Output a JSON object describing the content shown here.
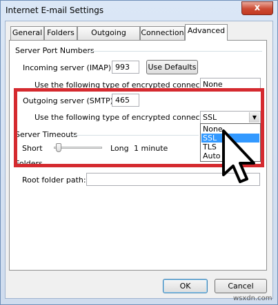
{
  "window": {
    "title": "Internet E-mail Settings",
    "close_glyph": "x"
  },
  "tabs": [
    {
      "label": "General"
    },
    {
      "label": "Folders"
    },
    {
      "label": "Outgoing Server"
    },
    {
      "label": "Connection"
    },
    {
      "label": "Advanced",
      "active": true
    }
  ],
  "server_ports": {
    "group_label": "Server Port Numbers",
    "incoming_label": "Incoming server (IMAP):",
    "incoming_value": "993",
    "use_defaults_label": "Use Defaults",
    "incoming_encryption_label": "Use the following type of encrypted connection:",
    "incoming_encryption_value": "None",
    "outgoing_label": "Outgoing server (SMTP):",
    "outgoing_value": "465",
    "outgoing_encryption_label": "Use the following type of encrypted connection:",
    "outgoing_encryption_value": "SSL",
    "options": [
      "None",
      "SSL",
      "TLS",
      "Auto"
    ],
    "selected_option": "SSL"
  },
  "timeouts": {
    "group_label": "Server Timeouts",
    "short_label": "Short",
    "long_label": "Long",
    "value": "1 minute",
    "slider_level": 0.05
  },
  "folders": {
    "group_label": "Folders",
    "root_label": "Root folder path:",
    "root_value": ""
  },
  "footer": {
    "ok_label": "OK",
    "cancel_label": "Cancel"
  },
  "watermark": "wsxdn.com",
  "colors": {
    "highlight_box": "#d52a2f",
    "selection": "#3399ff"
  },
  "icons": [
    "close-icon",
    "chevron-down-icon",
    "mouse-cursor-icon"
  ]
}
